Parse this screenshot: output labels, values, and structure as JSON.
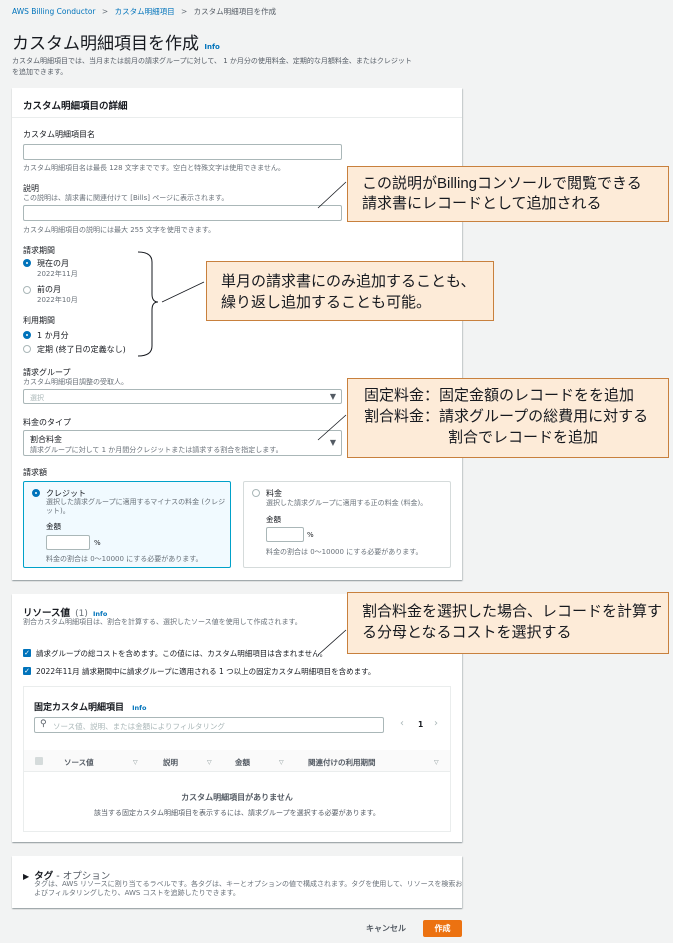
{
  "breadcrumb": {
    "root": "AWS Billing Conductor",
    "sep": ">",
    "section": "カスタム明細項目",
    "current": "カスタム明細項目を作成"
  },
  "page": {
    "title": "カスタム明細項目を作成",
    "info": "Info",
    "desc1": "カスタム明細項目では、当月または前月の請求グループに対して、 1 か月分の使用料金、定期的な月額料金、またはクレジット",
    "desc2": "を追加できます。"
  },
  "details": {
    "heading": "カスタム明細項目の詳細",
    "name_label": "カスタム明細項目名",
    "name_hint": "カスタム明細項目名は最長 128 文字までです。空白と特殊文字は使用できません。",
    "desc_label": "説明",
    "desc_sub": "この説明は、請求書に関連付けて [Bills] ページに表示されます。",
    "desc_hint": "カスタム明細項目の説明には最大 255 文字を使用できます。",
    "period_label": "請求期間",
    "period_current": "現在の月",
    "period_current_sub": "2022年11月",
    "period_prev": "前の月",
    "period_prev_sub": "2022年10月",
    "usage_label": "利用期間",
    "usage_1m": "1 か月分",
    "usage_recurring": "定期 (終了日の定義なし)",
    "group_label": "請求グループ",
    "group_sub": "カスタム明細項目調整の受取人。",
    "group_placeholder": "選択",
    "type_label": "料金のタイプ",
    "type_value": "割合料金",
    "type_sub": "請求グループに対して 1 か月間分クレジットまたは請求する割合を指定します。",
    "amount_label": "請求額",
    "credit_title": "クレジット",
    "credit_desc1": "選択した請求グループに適用するマイナスの料金 (クレジ",
    "credit_desc2": "ット)。",
    "credit_amount": "金額",
    "credit_unit": "%",
    "credit_hint": "料金の割合は 0～10000 にする必要があります。",
    "fee_title": "料金",
    "fee_desc": "選択した請求グループに適用する正の料金 (料金)。",
    "fee_amount": "金額",
    "fee_unit": "%",
    "fee_hint": "料金の割合は 0～10000 にする必要があります。"
  },
  "resource": {
    "heading": "リソース値",
    "count": "(1)",
    "info": "Info",
    "desc": "割合カスタム明細項目は、割合を計算する、選択したソース値を使用して作成されます。",
    "check1": "請求グループの総コストを含めます。この値には、カスタム明細項目は含まれません。",
    "check2": "2022年11月 請求期間中に請求グループに適用される 1 つ以上の固定カスタム明細項目を含めます。",
    "table_title": "固定カスタム明細項目",
    "table_info": "Info",
    "filter_placeholder": "ソース値、説明、または金額によりフィルタリング",
    "page_num": "1",
    "columns": [
      "ソース値",
      "説明",
      "金額",
      "関連付けの利用期間"
    ],
    "empty_title": "カスタム明細項目がありません",
    "empty_desc": "該当する固定カスタム明細項目を表示するには、請求グループを選択する必要があります。"
  },
  "tags": {
    "heading": "タグ",
    "suffix": " - オプション",
    "desc1": "タグは、AWS リソースに割り当てるラベルです。各タグは、キーとオプションの値で構成されます。タグを使用して、リソースを検索お",
    "desc2": "よびフィルタリングしたり、AWS コストを追跡したりできます。"
  },
  "footer": {
    "cancel": "キャンセル",
    "create": "作成"
  },
  "notes": {
    "n1_l1": "この説明がBillingコンソールで閲覧できる",
    "n1_l2": "請求書にレコードとして追加される",
    "n2_l1": "単月の請求書にのみ追加することも、",
    "n2_l2": "繰り返し追加することも可能。",
    "n3_l1": "固定料金：固定金額のレコードをを追加",
    "n3_l2": "割合料金：請求グループの総費用に対する",
    "n3_l3": "割合でレコードを追加",
    "n4_l1": "割合料金を選択した場合、レコードを計算す",
    "n4_l2": "る分母となるコストを選択する"
  },
  "colors": {
    "accent": "#ec7211",
    "link": "#0073bb",
    "note_bg": "#fdebd8",
    "note_border": "#c8803d"
  }
}
